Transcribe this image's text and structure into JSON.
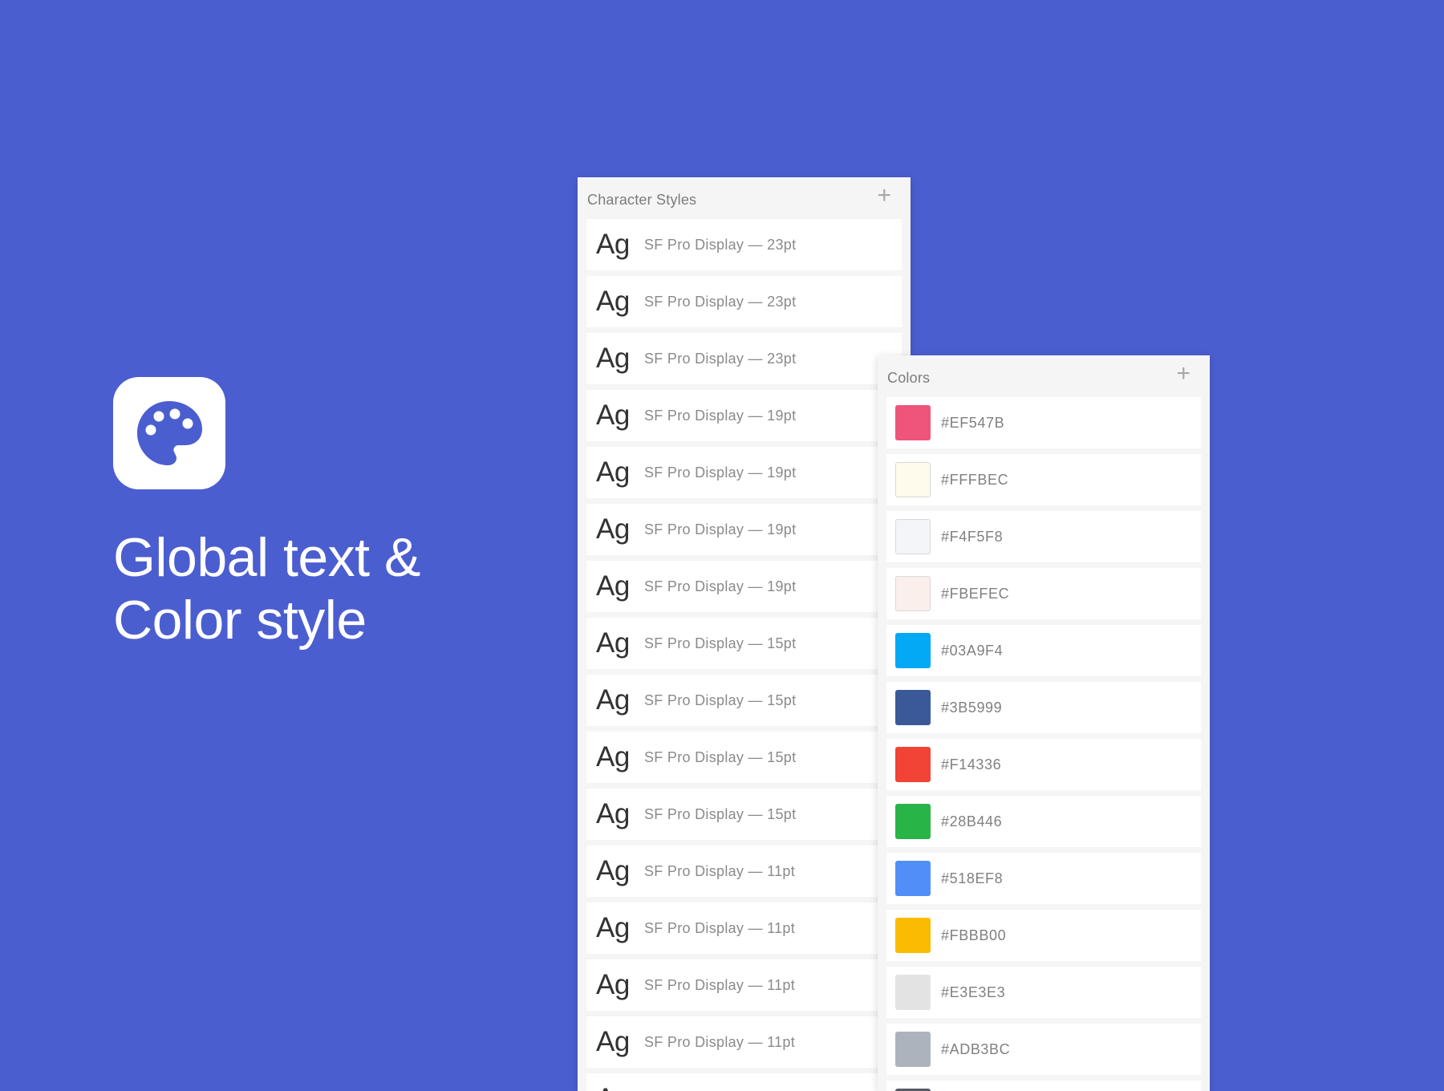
{
  "headline": {
    "line1": "Global text &",
    "line2": "Color style"
  },
  "icon": {
    "name": "palette-icon",
    "background": "#FFFFFF",
    "foreground": "#4B5ED0"
  },
  "page": {
    "background": "#4B5ED0"
  },
  "character_styles": {
    "title": "Character Styles",
    "add_label": "+",
    "sample_glyph": "Ag",
    "items": [
      {
        "label": "SF Pro Display — 23pt"
      },
      {
        "label": "SF Pro Display — 23pt"
      },
      {
        "label": "SF Pro Display — 23pt"
      },
      {
        "label": "SF Pro Display — 19pt"
      },
      {
        "label": "SF Pro Display — 19pt"
      },
      {
        "label": "SF Pro Display — 19pt"
      },
      {
        "label": "SF Pro Display — 19pt"
      },
      {
        "label": "SF Pro Display — 15pt"
      },
      {
        "label": "SF Pro Display — 15pt"
      },
      {
        "label": "SF Pro Display — 15pt"
      },
      {
        "label": "SF Pro Display — 15pt"
      },
      {
        "label": "SF Pro Display — 11pt"
      },
      {
        "label": "SF Pro Display — 11pt"
      },
      {
        "label": "SF Pro Display — 11pt"
      },
      {
        "label": "SF Pro Display — 11pt"
      },
      {
        "label": ""
      }
    ]
  },
  "colors": {
    "title": "Colors",
    "add_label": "+",
    "items": [
      {
        "hex": "#EF547B",
        "swatch": "#EF547B",
        "light": false
      },
      {
        "hex": "#FFFBEC",
        "swatch": "#FFFBEC",
        "light": true
      },
      {
        "hex": "#F4F5F8",
        "swatch": "#F4F5F8",
        "light": true
      },
      {
        "hex": "#FBEFEC",
        "swatch": "#FBEFEC",
        "light": true
      },
      {
        "hex": "#03A9F4",
        "swatch": "#03A9F4",
        "light": false
      },
      {
        "hex": "#3B5999",
        "swatch": "#3B5999",
        "light": false
      },
      {
        "hex": "#F14336",
        "swatch": "#F14336",
        "light": false
      },
      {
        "hex": "#28B446",
        "swatch": "#28B446",
        "light": false
      },
      {
        "hex": "#518EF8",
        "swatch": "#518EF8",
        "light": false
      },
      {
        "hex": "#FBBB00",
        "swatch": "#FBBB00",
        "light": false
      },
      {
        "hex": "#E3E3E3",
        "swatch": "#E3E3E3",
        "light": false
      },
      {
        "hex": "#ADB3BC",
        "swatch": "#ADB3BC",
        "light": false
      },
      {
        "hex": "",
        "swatch": "#555A63",
        "light": false
      }
    ]
  }
}
